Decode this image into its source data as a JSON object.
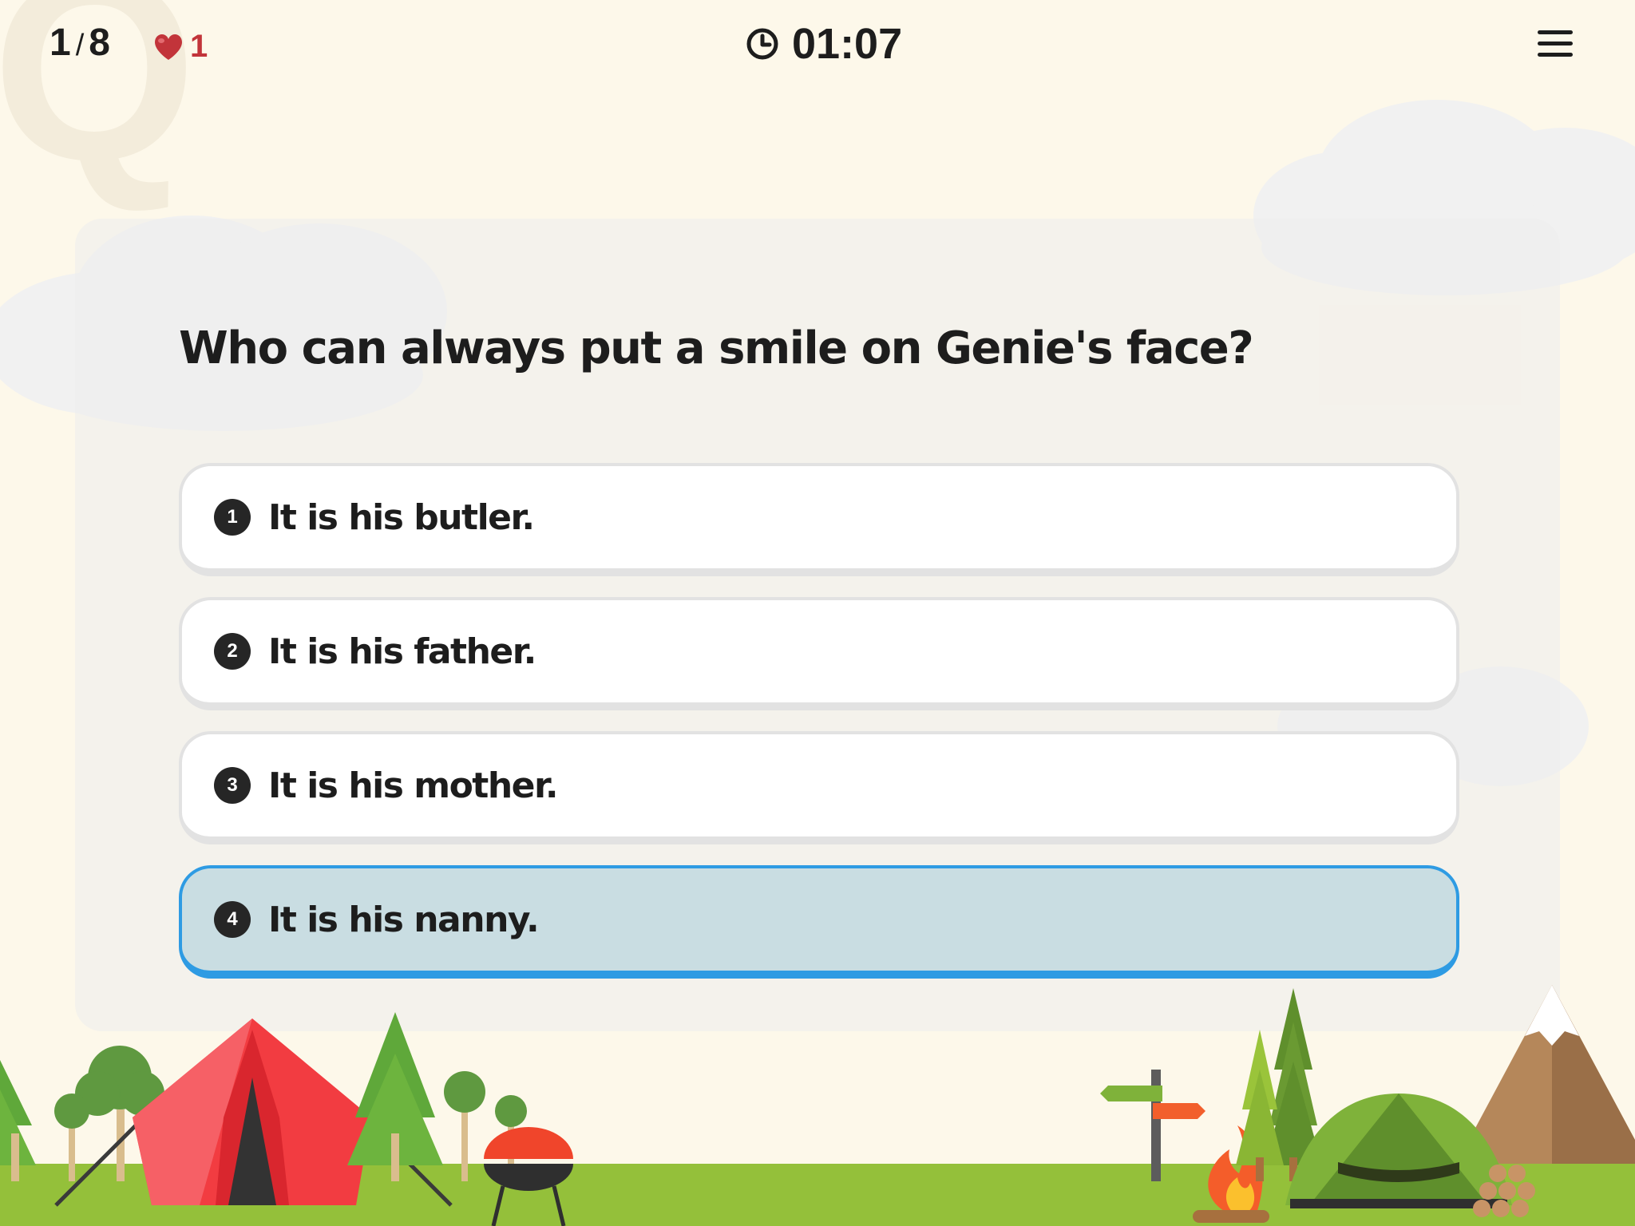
{
  "header": {
    "progress_current": "1",
    "progress_separator": "/",
    "progress_total": "8",
    "lives": "1",
    "timer": "01:07"
  },
  "question": {
    "text": "Who can always put a smile on Genie's face?"
  },
  "answers": [
    {
      "number": "1",
      "text": "It is his butler.",
      "selected": false
    },
    {
      "number": "2",
      "text": "It is his father.",
      "selected": false
    },
    {
      "number": "3",
      "text": "It is his mother.",
      "selected": false
    },
    {
      "number": "4",
      "text": "It is his nanny.",
      "selected": true
    }
  ],
  "colors": {
    "background": "#fdf8ea",
    "selected_fill": "#c9dde2",
    "selected_border": "#2e9be3",
    "heart": "#c2343a",
    "grass": "#94c03a"
  },
  "icons": [
    "heart-icon",
    "clock-icon",
    "hamburger-menu-icon"
  ]
}
